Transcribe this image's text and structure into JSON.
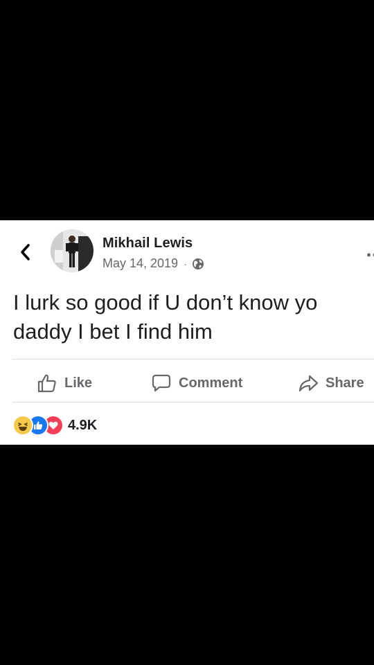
{
  "post": {
    "author": "Mikhail Lewis",
    "date": "May 14, 2019",
    "separator": "·",
    "privacy_icon": "globe-icon",
    "text": "I lurk so good if U don’t know yo daddy I bet I find him"
  },
  "actions": {
    "like_label": "Like",
    "comment_label": "Comment",
    "share_label": "Share"
  },
  "reactions": {
    "types": [
      "haha",
      "like",
      "love"
    ],
    "count": "4.9K"
  },
  "colors": {
    "background": "#000000",
    "card": "#ffffff",
    "text_primary": "#1c1e21",
    "text_secondary": "#65676b",
    "divider": "#dadde1",
    "like_blue": "#1877f2",
    "love_red": "#f33e58",
    "haha_yellow": "#f7c94b"
  }
}
